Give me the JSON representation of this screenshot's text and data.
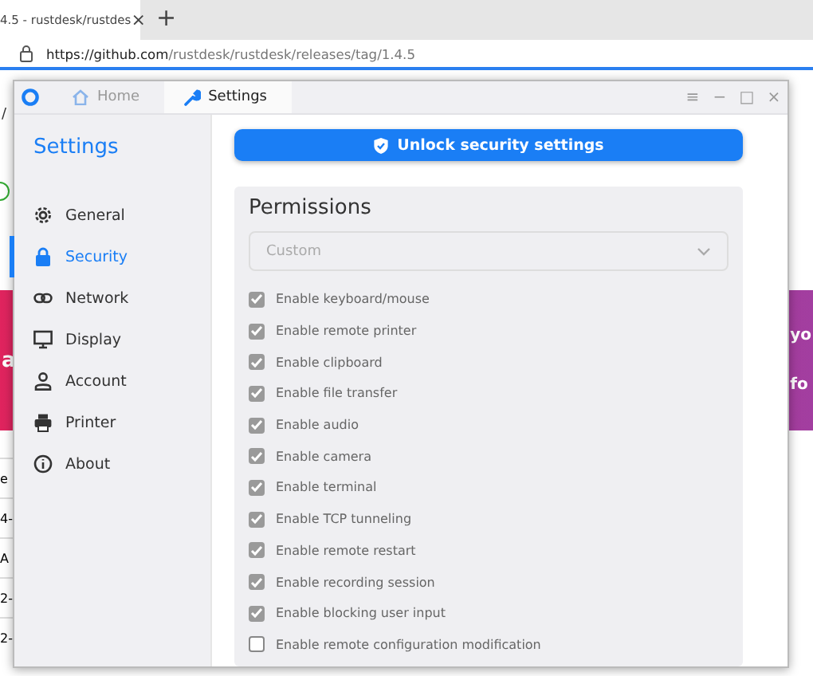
{
  "browser": {
    "tab_title": "4.5 - rustdesk/rustdes",
    "tab_close": "×",
    "new_tab": "+",
    "url_host": "https://github.com",
    "url_path": "/rustdesk/rustdesk/releases/tag/1.4.5"
  },
  "background_page": {
    "breadcrumb": "/",
    "banner_left": "a",
    "banner_right": [
      "yo",
      "fo"
    ],
    "table_fragments": [
      "e",
      "4-",
      "A",
      "2-",
      "2-"
    ]
  },
  "window": {
    "tabs": [
      {
        "label": "Home",
        "kind": "home",
        "selected": false
      },
      {
        "label": "Settings",
        "kind": "settings",
        "selected": true
      }
    ],
    "controls": [
      "≡",
      "−",
      "□",
      "×"
    ]
  },
  "sidebar": {
    "title": "Settings",
    "items": [
      {
        "label": "General",
        "kind": "gear",
        "selected": false
      },
      {
        "label": "Security",
        "kind": "lock",
        "selected": true
      },
      {
        "label": "Network",
        "kind": "link",
        "selected": false
      },
      {
        "label": "Display",
        "kind": "monitor",
        "selected": false
      },
      {
        "label": "Account",
        "kind": "person",
        "selected": false
      },
      {
        "label": "Printer",
        "kind": "printer",
        "selected": false
      },
      {
        "label": "About",
        "kind": "info",
        "selected": false
      }
    ]
  },
  "unlock_button": "Unlock security settings",
  "permissions": {
    "title": "Permissions",
    "mode": {
      "value": "Custom",
      "disabled": true
    },
    "options": [
      {
        "label": "Enable keyboard/mouse",
        "checked": true
      },
      {
        "label": "Enable remote printer",
        "checked": true
      },
      {
        "label": "Enable clipboard",
        "checked": true
      },
      {
        "label": "Enable file transfer",
        "checked": true
      },
      {
        "label": "Enable audio",
        "checked": true
      },
      {
        "label": "Enable camera",
        "checked": true
      },
      {
        "label": "Enable terminal",
        "checked": true
      },
      {
        "label": "Enable TCP tunneling",
        "checked": true
      },
      {
        "label": "Enable remote restart",
        "checked": true
      },
      {
        "label": "Enable recording session",
        "checked": true
      },
      {
        "label": "Enable blocking user input",
        "checked": true
      },
      {
        "label": "Enable remote configuration modification",
        "checked": false
      }
    ]
  }
}
